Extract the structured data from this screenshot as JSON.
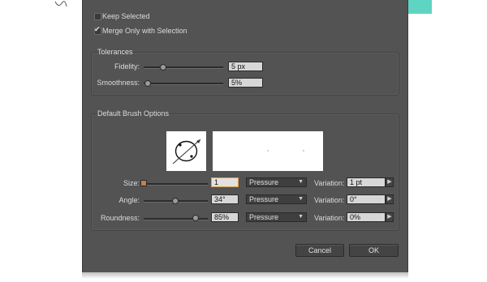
{
  "options": {
    "keep_selected": {
      "label": "Keep Selected",
      "checked": false
    },
    "merge_only": {
      "label": "Merge Only with Selection",
      "checked": true
    }
  },
  "tolerances": {
    "title": "Tolerances",
    "fidelity": {
      "label": "Fidelity:",
      "value": "5 px"
    },
    "smoothness": {
      "label": "Smoothness:",
      "value": "5%"
    }
  },
  "brush_options": {
    "title": "Default Brush Options",
    "rows": [
      {
        "label": "Size:",
        "value": "1",
        "dynamic": "Pressure",
        "variation_label": "Variation:",
        "variation": "1 pt"
      },
      {
        "label": "Angle:",
        "value": "34°",
        "dynamic": "Pressure",
        "variation_label": "Variation:",
        "variation": "0°"
      },
      {
        "label": "Roundness:",
        "value": "85%",
        "dynamic": "Pressure",
        "variation_label": "Variation:",
        "variation": "0%"
      }
    ]
  },
  "buttons": {
    "cancel": "Cancel",
    "ok": "OK"
  },
  "colors": {
    "panel": "#535353",
    "accent": "#5fd4c3"
  }
}
